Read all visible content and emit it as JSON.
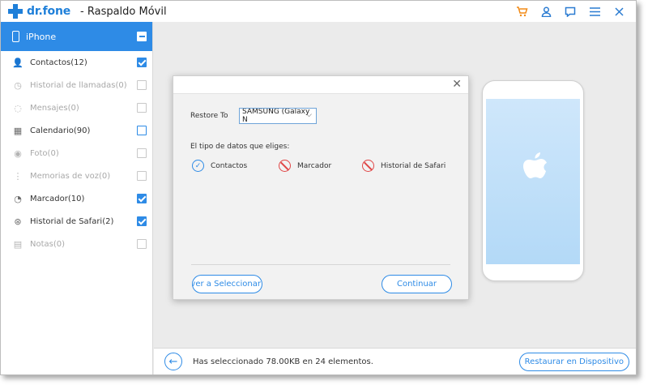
{
  "app": {
    "brand": "dr.fone",
    "title": "- Raspaldo Móvil"
  },
  "titlebar_icons": [
    "cart-icon",
    "user-icon",
    "feedback-icon",
    "menu-icon",
    "close-icon"
  ],
  "sidebar": {
    "device": "iPhone",
    "items": [
      {
        "label": "Contactos(12)",
        "icon": "person-icon",
        "state": "checked"
      },
      {
        "label": "Historial de llamadas(0)",
        "icon": "clock-icon",
        "state": "disabled"
      },
      {
        "label": "Mensajes(0)",
        "icon": "message-icon",
        "state": "disabled"
      },
      {
        "label": "Calendario(90)",
        "icon": "calendar-icon",
        "state": "unchecked"
      },
      {
        "label": "Foto(0)",
        "icon": "camera-icon",
        "state": "disabled"
      },
      {
        "label": "Memorias de voz(0)",
        "icon": "waveform-icon",
        "state": "disabled"
      },
      {
        "label": "Marcador(10)",
        "icon": "bookmark-icon",
        "state": "checked"
      },
      {
        "label": "Historial de Safari(2)",
        "icon": "compass-icon",
        "state": "checked"
      },
      {
        "label": "Notas(0)",
        "icon": "notes-icon",
        "state": "disabled"
      }
    ]
  },
  "dialog": {
    "restore_label": "Restore To",
    "device_select": "SAMSUNG (Galaxy N",
    "types_title": "El tipo de datos que eliges:",
    "types": [
      {
        "label": "Contactos",
        "status": "ok"
      },
      {
        "label": "Marcador",
        "status": "unavailable"
      },
      {
        "label": "Historial de Safari",
        "status": "unavailable"
      }
    ],
    "back_button": "olver a Seleccionar",
    "continue_button": "Continuar"
  },
  "bottom": {
    "status": "Has seleccionado 78.00KB en 24 elementos.",
    "restore_button": "Restaurar en Dispositivo"
  },
  "colors": {
    "accent": "#2e8be6",
    "cart": "#f28a16",
    "error": "#e04646"
  }
}
